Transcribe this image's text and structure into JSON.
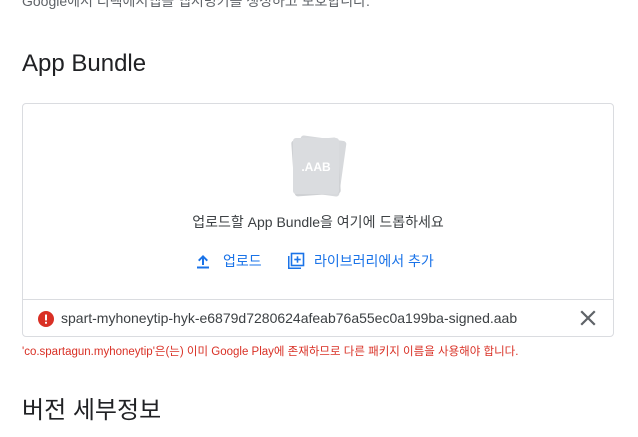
{
  "header": {
    "intro_text": "Google에서 디렉에서앱을 앱서명키를 생성하고 보호합니다."
  },
  "app_bundle": {
    "title": "App Bundle",
    "file_icon_label": ".AAB",
    "drop_text": "업로드할 App Bundle을 여기에 드롭하세요",
    "upload_label": "업로드",
    "library_label": "라이브러리에서 추가",
    "file_name": "spart-myhoneytip-hyk-e6879d7280624afeab76a55ec0a199ba-signed.aab",
    "error_message": "'co.spartagun.myhoneytip'은(는) 이미 Google Play에 존재하므로 다른 패키지 이름을 사용해야 합니다."
  },
  "version_details": {
    "title": "버전 세부정보"
  },
  "colors": {
    "accent": "#1a73e8",
    "error": "#d93025",
    "border": "#dadce0"
  }
}
